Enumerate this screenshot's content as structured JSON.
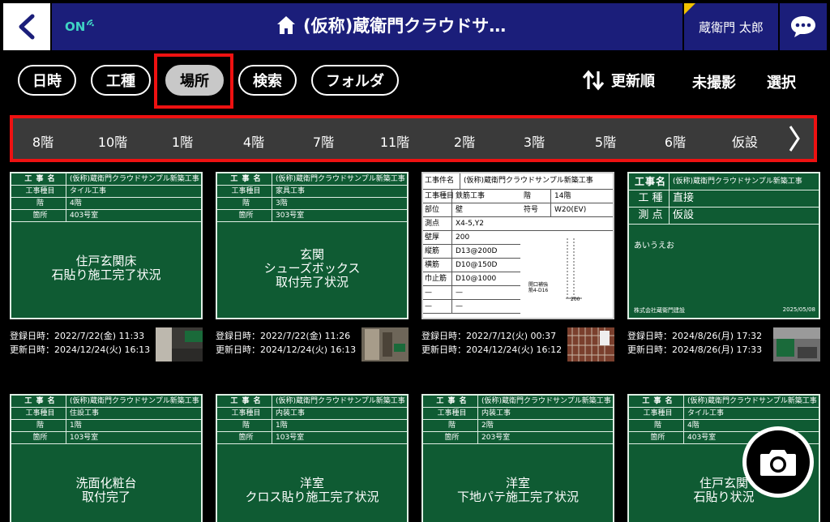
{
  "header": {
    "back_label": "<",
    "status": "ON",
    "title": "(仮称)蔵衛門クラウドサ…",
    "user": "蔵衛門 太郎"
  },
  "toolbar": {
    "filters": [
      "日時",
      "工種",
      "場所",
      "検索",
      "フォルダ"
    ],
    "active_filter": "場所",
    "sort_label": "更新順",
    "unshot_label": "未撮影",
    "select_label": "選択"
  },
  "floors": [
    "8階",
    "10階",
    "1階",
    "4階",
    "7階",
    "11階",
    "2階",
    "3階",
    "5階",
    "6階",
    "仮設"
  ],
  "photos": [
    {
      "k1": "工 事 名",
      "v1": "(仮称)蔵衛門クラウドサンプル新築工事",
      "k2": "工事種目",
      "v2": "タイル工事",
      "k3": "階",
      "v3": "4階",
      "k4": "箇所",
      "v4": "403号室",
      "line1": "住戸玄関床",
      "line2": "石貼り施工完了状況",
      "registered": "登録日時：2022/7/22(金) 11:33",
      "updated": "更新日時：2024/12/24(火) 16:13"
    },
    {
      "k1": "工 事 名",
      "v1": "(仮称)蔵衛門クラウドサンプル新築工事",
      "k2": "工事種目",
      "v2": "家具工事",
      "k3": "階",
      "v3": "3階",
      "k4": "箇所",
      "v4": "303号室",
      "line0": "玄関",
      "line1": "シューズボックス",
      "line2": "取付完了状況",
      "registered": "登録日時：2022/7/22(金) 11:26",
      "updated": "更新日時：2024/12/24(火) 16:13"
    },
    {
      "k1": "工事件名",
      "v1": "(仮称)蔵衛門クラウドサンプル新築工事",
      "k2": "工事種目",
      "v2": "鉄筋工事",
      "k2b": "階",
      "v2b": "14階",
      "k3": "部位",
      "v3": "壁",
      "k3b": "符号",
      "v3b": "W20(EV)",
      "k4": "測点",
      "v4": "X4-5,Y2",
      "k5": "壁厚",
      "v5": "200",
      "k6": "縦筋",
      "v6": "D13@200D",
      "k7": "横筋",
      "v7": "D10@150D",
      "k8": "巾止筋",
      "v8": "D10@1000",
      "k9": "—",
      "k10": "—",
      "diagram_label": "開口補強筋4-D16",
      "diagram_dim": "200",
      "registered": "登録日時：2022/7/12(火) 00:37",
      "updated": "更新日時：2024/12/24(火) 16:12"
    },
    {
      "k1": "工事名",
      "v1": "(仮称)蔵衛門クラウドサンプル新築工事",
      "k2": "工 種",
      "v2": "直接",
      "k3": "測 点",
      "v3": "仮設",
      "note": "あいうえお",
      "company": "株式会社蔵衛門建設",
      "date": "2025/05/08",
      "registered": "登録日時：2024/8/26(月) 17:32",
      "updated": "更新日時：2024/8/26(月) 17:33"
    },
    {
      "k1": "工 事 名",
      "v1": "(仮称)蔵衛門クラウドサンプル新築工事",
      "k2": "工事種目",
      "v2": "住設工事",
      "k3": "階",
      "v3": "1階",
      "k4": "箇所",
      "v4": "103号室",
      "line1": "洗面化粧台",
      "line2": "取付完了"
    },
    {
      "k1": "工 事 名",
      "v1": "(仮称)蔵衛門クラウドサンプル新築工事",
      "k2": "工事種目",
      "v2": "内装工事",
      "k3": "階",
      "v3": "1階",
      "k4": "箇所",
      "v4": "103号室",
      "line1": "洋室",
      "line2": "クロス貼り施工完了状況"
    },
    {
      "k1": "工 事 名",
      "v1": "(仮称)蔵衛門クラウドサンプル新築工事",
      "k2": "工事種目",
      "v2": "内装工事",
      "k3": "階",
      "v3": "2階",
      "k4": "箇所",
      "v4": "203号室",
      "line1": "洋室",
      "line2": "下地パテ施工完了状況"
    },
    {
      "k1": "工 事 名",
      "v1": "(仮称)蔵衛門クラウドサンプル新築工事",
      "k2": "工事種目",
      "v2": "タイル工事",
      "k3": "階",
      "v3": "4階",
      "k4": "箇所",
      "v4": "403号室",
      "line1": "住戸玄関",
      "line2": "石貼り状況"
    }
  ],
  "colors": {
    "header_bg": "#1b1e7a",
    "accent_red": "#ee1111",
    "board_green": "#0f5b33",
    "status_teal": "#3fd3c4"
  },
  "icons": {
    "back": "chevron-left-icon",
    "wifi": "wifi-icon",
    "home": "home-icon",
    "chat": "chat-bubble-icon",
    "sort": "sort-arrows-icon",
    "camera": "camera-icon",
    "next": "chevron-right-icon"
  }
}
